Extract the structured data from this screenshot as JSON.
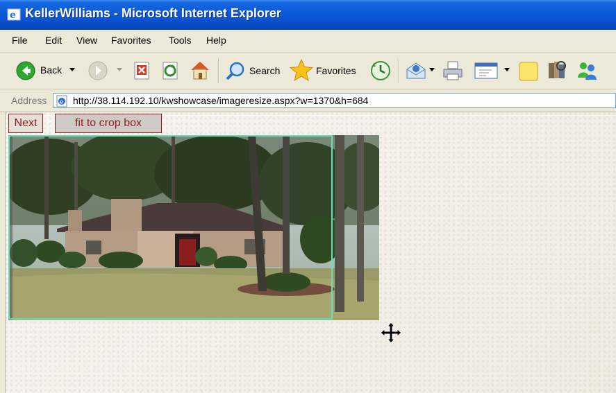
{
  "window": {
    "title": "KellerWilliams - Microsoft Internet Explorer"
  },
  "menu": {
    "items": [
      "File",
      "Edit",
      "View",
      "Favorites",
      "Tools",
      "Help"
    ]
  },
  "toolbar": {
    "back_label": "Back",
    "search_label": "Search",
    "favorites_label": "Favorites"
  },
  "address": {
    "label": "Address",
    "url": "http://38.114.192.10/kwshowcase/imageresize.aspx?w=1370&h=684"
  },
  "page": {
    "next_button": "Next",
    "fit_button": "fit to crop box"
  },
  "colors": {
    "titlebar": "#0a55d6",
    "crop_box_border": "#5fe3b5",
    "button_border": "#8b1f1f",
    "button_text": "#8b1f1f"
  },
  "icons": [
    "ie-logo-icon",
    "back-arrow-icon",
    "forward-arrow-icon",
    "stop-icon",
    "refresh-icon",
    "home-icon",
    "search-icon",
    "favorites-star-icon",
    "history-icon",
    "mail-icon",
    "print-icon",
    "edit-icon",
    "notes-icon",
    "research-icon",
    "messenger-icon",
    "page-icon",
    "move-cursor-icon"
  ]
}
